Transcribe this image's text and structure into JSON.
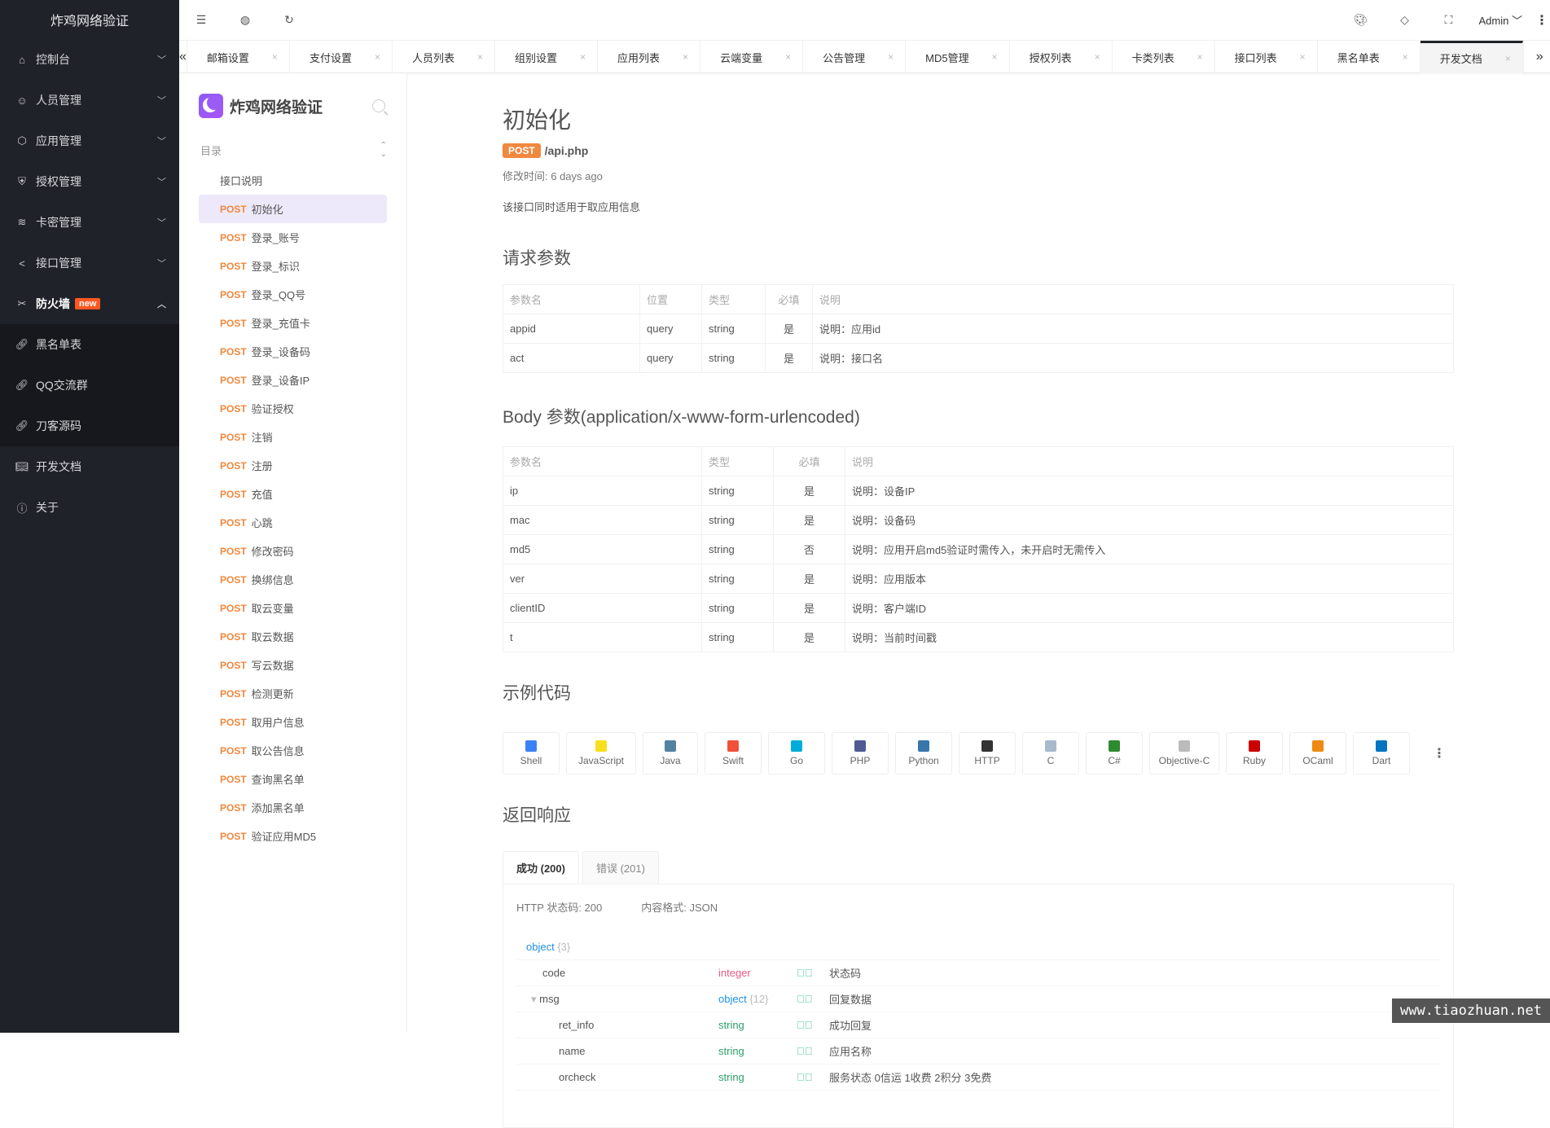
{
  "sidebar": {
    "app_title": "炸鸡网络验证",
    "items": [
      {
        "label": "控制台",
        "icon": "home-icon"
      },
      {
        "label": "人员管理",
        "icon": "users-icon"
      },
      {
        "label": "应用管理",
        "icon": "cube-icon"
      },
      {
        "label": "授权管理",
        "icon": "shield-check-icon"
      },
      {
        "label": "卡密管理",
        "icon": "layers-icon"
      },
      {
        "label": "接口管理",
        "icon": "share-icon"
      },
      {
        "label": "防火墙",
        "icon": "tools-icon",
        "badge": "new"
      },
      {
        "label": "黑名单表",
        "icon": "link-icon"
      },
      {
        "label": "QQ交流群",
        "icon": "link-icon"
      },
      {
        "label": "刀客源码",
        "icon": "link-icon"
      },
      {
        "label": "开发文档",
        "icon": "book-icon"
      },
      {
        "label": "关于",
        "icon": "info-icon"
      }
    ]
  },
  "header": {
    "user": "Admin",
    "icons": [
      "menu-fold-icon",
      "globe-icon",
      "refresh-icon",
      "palette-icon",
      "tag-icon",
      "fullscreen-icon",
      "more-vertical-icon"
    ]
  },
  "tabs": [
    {
      "label": "邮箱设置"
    },
    {
      "label": "支付设置"
    },
    {
      "label": "人员列表"
    },
    {
      "label": "组别设置"
    },
    {
      "label": "应用列表"
    },
    {
      "label": "云端变量"
    },
    {
      "label": "公告管理"
    },
    {
      "label": "MD5管理"
    },
    {
      "label": "授权列表"
    },
    {
      "label": "卡类列表"
    },
    {
      "label": "接口列表"
    },
    {
      "label": "黑名单表"
    },
    {
      "label": "开发文档",
      "active": true
    }
  ],
  "docnav": {
    "title": "炸鸡网络验证",
    "toc_label": "目录",
    "intro": "接口说明",
    "method": "POST",
    "items": [
      "初始化",
      "登录_账号",
      "登录_标识",
      "登录_QQ号",
      "登录_充值卡",
      "登录_设备码",
      "登录_设备IP",
      "验证授权",
      "注销",
      "注册",
      "充值",
      "心跳",
      "修改密码",
      "换绑信息",
      "取云变量",
      "取云数据",
      "写云数据",
      "检测更新",
      "取用户信息",
      "取公告信息",
      "查询黑名单",
      "添加黑名单",
      "验证应用MD5"
    ],
    "active_index": 0
  },
  "main": {
    "title": "初始化",
    "method": "POST",
    "path": "/api.php",
    "modified": "修改时间: 6 days ago",
    "description": "该接口同时适用于取应用信息",
    "request_params_title": "请求参数",
    "request_headers": [
      "参数名",
      "位置",
      "类型",
      "必填",
      "说明"
    ],
    "request_rows": [
      [
        "appid",
        "query",
        "string",
        "是",
        "说明：应用id"
      ],
      [
        "act",
        "query",
        "string",
        "是",
        "说明：接口名"
      ]
    ],
    "body_title": "Body 参数(application/x-www-form-urlencoded)",
    "body_headers": [
      "参数名",
      "类型",
      "必填",
      "说明"
    ],
    "body_rows": [
      [
        "ip",
        "string",
        "是",
        "说明：设备IP"
      ],
      [
        "mac",
        "string",
        "是",
        "说明：设备码"
      ],
      [
        "md5",
        "string",
        "否",
        "说明：应用开启md5验证时需传入，未开启时无需传入"
      ],
      [
        "ver",
        "string",
        "是",
        "说明：应用版本"
      ],
      [
        "clientID",
        "string",
        "是",
        "说明：客户端ID"
      ],
      [
        "t",
        "string",
        "是",
        "说明：当前时间戳"
      ]
    ],
    "code_title": "示例代码",
    "languages": [
      {
        "label": "Shell",
        "icon": "shell-icon",
        "color": "#3b82f6"
      },
      {
        "label": "JavaScript",
        "icon": "javascript-icon",
        "color": "#f7df1e"
      },
      {
        "label": "Java",
        "icon": "java-icon",
        "color": "#5382a1"
      },
      {
        "label": "Swift",
        "icon": "swift-icon",
        "color": "#f05138"
      },
      {
        "label": "Go",
        "icon": "go-icon",
        "color": "#00add8"
      },
      {
        "label": "PHP",
        "icon": "php-icon",
        "color": "#4f5b93"
      },
      {
        "label": "Python",
        "icon": "python-icon",
        "color": "#3776ab"
      },
      {
        "label": "HTTP",
        "icon": "http-icon",
        "color": "#333333"
      },
      {
        "label": "C",
        "icon": "c-icon",
        "color": "#a8b9cc"
      },
      {
        "label": "C#",
        "icon": "csharp-icon",
        "color": "#2e8b2e"
      },
      {
        "label": "Objective-C",
        "icon": "objective-c-icon",
        "color": "#bbbbbb"
      },
      {
        "label": "Ruby",
        "icon": "ruby-icon",
        "color": "#cc0000"
      },
      {
        "label": "OCaml",
        "icon": "ocaml-icon",
        "color": "#ee8a12"
      },
      {
        "label": "Dart",
        "icon": "dart-icon",
        "color": "#0175c2"
      }
    ],
    "response_title": "返回响应",
    "response_tabs": [
      {
        "label": "成功 (200)",
        "active": true
      },
      {
        "label": "错误 (201)"
      }
    ],
    "status_label": "HTTP 状态码: 200",
    "content_type_label": "内容格式: JSON",
    "root_type": "object",
    "root_count": "{3}",
    "fields": [
      {
        "name": "code",
        "type": "integer",
        "desc": "状态码",
        "depth": 1
      },
      {
        "name": "msg",
        "type": "object",
        "count": "{12}",
        "desc": "回复数据",
        "depth": 1,
        "expanded": true
      },
      {
        "name": "ret_info",
        "type": "string",
        "desc": "成功回复",
        "depth": 2
      },
      {
        "name": "name",
        "type": "string",
        "desc": "应用名称",
        "depth": 2
      },
      {
        "name": "orcheck",
        "type": "string",
        "desc": "服务状态 0信运 1收费 2积分 3免费",
        "depth": 2
      }
    ]
  },
  "watermark": "www.tiaozhuan.net"
}
